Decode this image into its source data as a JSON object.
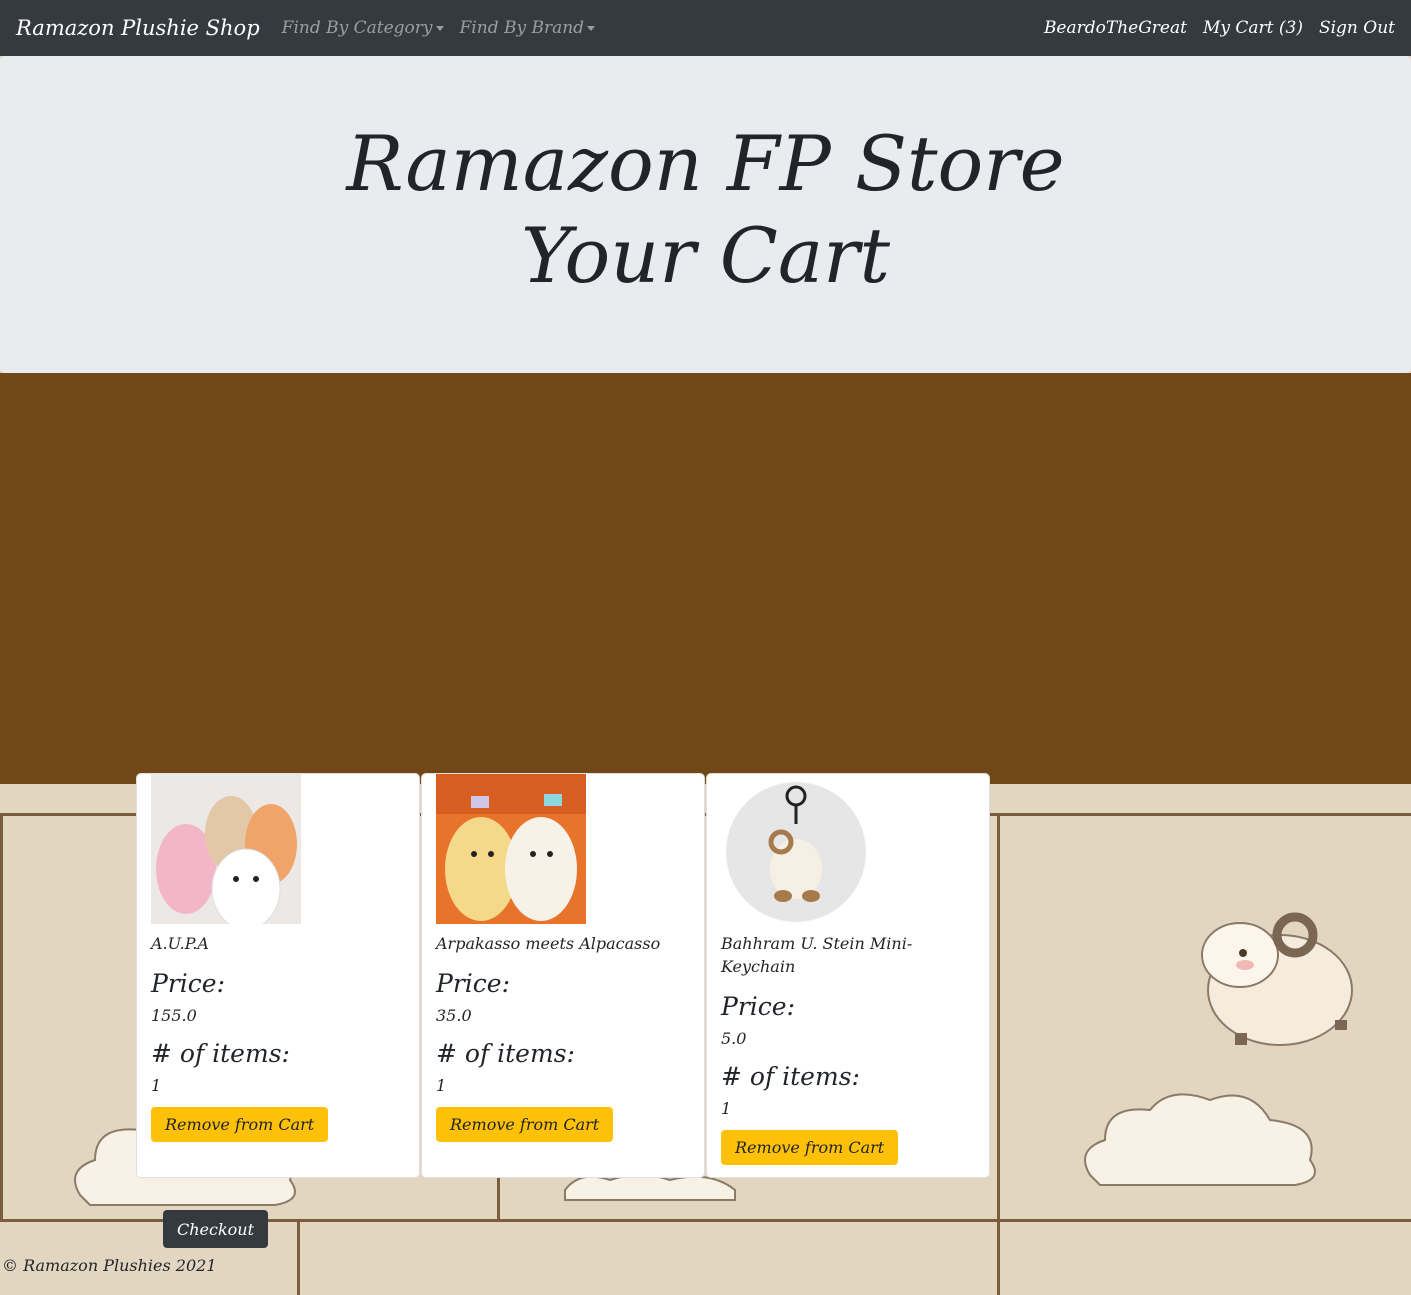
{
  "navbar": {
    "brand": "Ramazon Plushie Shop",
    "category": "Find By Category",
    "brand_menu": "Find By Brand",
    "user": "BeardoTheGreat",
    "cart": "My Cart (3)",
    "signout": "Sign Out"
  },
  "jumbotron": {
    "line1": "Ramazon FP Store",
    "line2": "Your Cart"
  },
  "labels": {
    "price": "Price:",
    "items": "# of items:",
    "remove": "Remove from Cart"
  },
  "cart_items": [
    {
      "name": "A.U.P.A",
      "price": "155.0",
      "count": "1"
    },
    {
      "name": "Arpakasso meets Alpacasso",
      "price": "35.0",
      "count": "1"
    },
    {
      "name": "Bahhram U. Stein Mini-Keychain",
      "price": "5.0",
      "count": "1"
    }
  ],
  "checkout_label": "Checkout",
  "footer": "© Ramazon Plushies 2021",
  "colors": {
    "navbar": "#343a40",
    "band": "#724717",
    "warning": "#ffc107",
    "jumbotron": "#e9ecef"
  }
}
